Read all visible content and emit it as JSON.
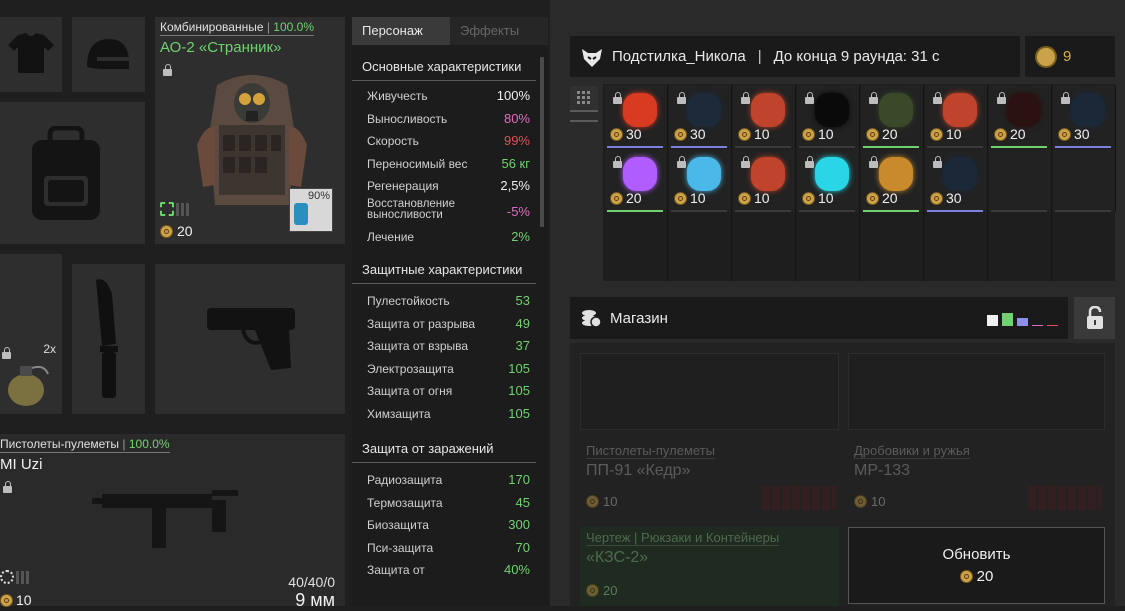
{
  "armor": {
    "category": "Комбинированные",
    "condition": "100.0%",
    "name": "АО-2 «Странник»",
    "slot_count": "90%",
    "price": "20"
  },
  "weapon": {
    "category": "Пистолеты-пулеметы",
    "condition": "100.0%",
    "name": "MI Uzi",
    "ammo_count": "40/40/0",
    "caliber": "9 мм",
    "price": "10"
  },
  "grenade": {
    "count": "2x"
  },
  "stats": {
    "tabs": [
      "Персонаж",
      "Эффекты"
    ],
    "sections": [
      {
        "title": "Основные характеристики",
        "rows": [
          {
            "label": "Живучесть",
            "value": "100%",
            "color": "#f0f0f0"
          },
          {
            "label": "Выносливость",
            "value": "80%",
            "color": "#e06ec0"
          },
          {
            "label": "Скорость",
            "value": "99%",
            "color": "#e0505a"
          },
          {
            "label": "Переносимый вес",
            "value": "56 кг",
            "color": "#6ed36e"
          },
          {
            "label": "Регенерация",
            "value": "2,5%",
            "color": "#f0f0f0"
          },
          {
            "label": "Восстановление выносливости",
            "value": "-5%",
            "color": "#e06ec0"
          },
          {
            "label": "Лечение",
            "value": "2%",
            "color": "#6ed36e"
          }
        ]
      },
      {
        "title": "Защитные характеристики",
        "rows": [
          {
            "label": "Пулестойкость",
            "value": "53",
            "color": "#6ed36e"
          },
          {
            "label": "Защита от разрыва",
            "value": "49",
            "color": "#6ed36e"
          },
          {
            "label": "Защита от взрыва",
            "value": "37",
            "color": "#6ed36e"
          },
          {
            "label": "Электрозащита",
            "value": "105",
            "color": "#6ed36e"
          },
          {
            "label": "Защита от огня",
            "value": "105",
            "color": "#6ed36e"
          },
          {
            "label": "Химзащита",
            "value": "105",
            "color": "#6ed36e"
          }
        ]
      },
      {
        "title": "Защита от заражений",
        "rows": [
          {
            "label": "Радиозащита",
            "value": "170",
            "color": "#6ed36e"
          },
          {
            "label": "Термозащита",
            "value": "45",
            "color": "#6ed36e"
          },
          {
            "label": "Биозащита",
            "value": "300",
            "color": "#6ed36e"
          },
          {
            "label": "Пси-защита",
            "value": "70",
            "color": "#6ed36e"
          },
          {
            "label": "Защита от",
            "value": "40%",
            "color": "#6ed36e"
          }
        ]
      }
    ]
  },
  "header": {
    "player": "Подстилка_Никола",
    "separator": "|",
    "round_text": "До конца 9 раунда: 31 с",
    "currency": "9"
  },
  "inventory": [
    {
      "price": "30",
      "color": "#d83a22",
      "line": "#7f7fe0"
    },
    {
      "price": "30",
      "color": "#1c2a3a",
      "line": "#7f7fe0"
    },
    {
      "price": "10",
      "color": "#c0442c",
      "line": "#3a3a3a"
    },
    {
      "price": "10",
      "color": "#0a0a0a",
      "line": "#3a3a3a"
    },
    {
      "price": "20",
      "color": "#3a4a28",
      "line": "#6ed36e"
    },
    {
      "price": "10",
      "color": "#c0442c",
      "line": "#3a3a3a"
    },
    {
      "price": "20",
      "color": "#2a1212",
      "line": "#6ed36e"
    },
    {
      "price": "30",
      "color": "#1a2838",
      "line": "#7f7fe0"
    },
    {
      "price": "20",
      "color": "#b05cff",
      "line": "#6ed36e"
    },
    {
      "price": "10",
      "color": "#4ab8e8",
      "line": "#3a3a3a"
    },
    {
      "price": "10",
      "color": "#c0442c",
      "line": "#3a3a3a"
    },
    {
      "price": "10",
      "color": "#28d6e6",
      "line": "#3a3a3a"
    },
    {
      "price": "20",
      "color": "#c88a2a",
      "line": "#6ed36e"
    },
    {
      "price": "30",
      "color": "#1a2838",
      "line": "#7f7fe0"
    }
  ],
  "shop": {
    "title": "Магазин",
    "filter_colors": [
      "#f0f0f0",
      "#6ed36e",
      "#8f8fe8",
      "#e06ec0",
      "#e0505a"
    ],
    "cards": [
      {
        "category": "Пистолеты-пулеметы",
        "name": "ПП-91 «Кедр»",
        "price": "10"
      },
      {
        "category": "Дробовики и ружья",
        "name": "МР-133",
        "price": "10"
      },
      {
        "category": "Чертеж | Рюкзаки и Контейнеры",
        "name": "«КЗС-2»",
        "price": "20"
      }
    ],
    "refresh_label": "Обновить",
    "refresh_price": "20"
  }
}
